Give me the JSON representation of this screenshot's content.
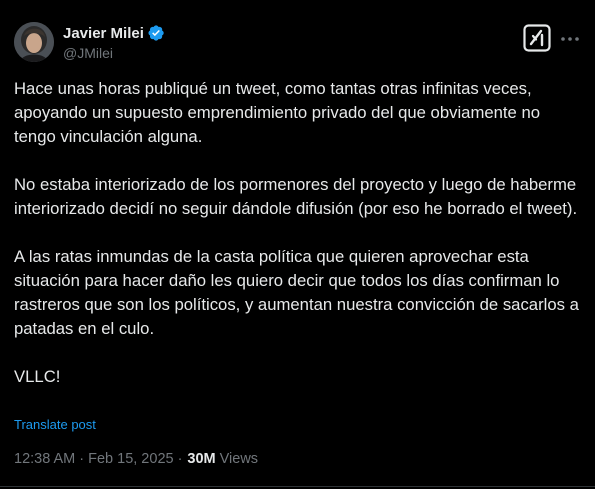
{
  "author": {
    "display_name": "Javier Milei",
    "handle": "@JMilei",
    "verified": true
  },
  "icons": {
    "avatar": "avatar",
    "verified": "verified-badge-icon",
    "grok": "grok-icon",
    "more": "more-options-icon"
  },
  "tweet": {
    "paragraphs": [
      "Hace unas horas publiqué un tweet, como tantas otras infinitas veces, apoyando un supuesto emprendimiento privado del que obviamente no tengo vinculación alguna.",
      "No estaba interiorizado de los pormenores del proyecto y luego de haberme interiorizado decidí no seguir dándole difusión (por eso he borrado el tweet).",
      "A las ratas inmundas de la casta política que quieren aprovechar esta situación para hacer daño les quiero decir que todos los días confirman lo rastreros que son los políticos, y aumentan nuestra convicción de sacarlos a patadas en el culo.",
      "VLLC!"
    ],
    "translate_label": "Translate post"
  },
  "meta": {
    "time": "12:38 AM",
    "separator": "·",
    "date": "Feb 15, 2025",
    "separator2": "·",
    "views_count": "30M",
    "views_label": "Views"
  },
  "colors": {
    "background": "#000000",
    "text_primary": "#e7e9ea",
    "text_secondary": "#71767b",
    "link": "#1d9bf0",
    "verified": "#1d9bf0"
  }
}
